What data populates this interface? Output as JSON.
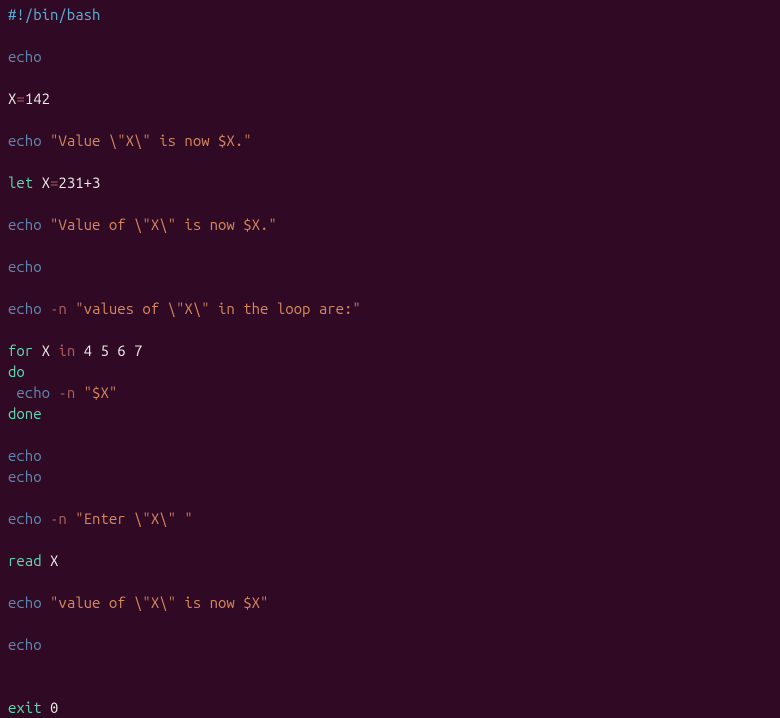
{
  "code": {
    "shebang": "#!/bin/bash",
    "echo_cmd": "echo",
    "var_x": "X",
    "assign_op": "=",
    "val_142": "142",
    "str_value_x_is_now": "\"Value \\\"X\\\" is now $X.\"",
    "let_cmd": "let",
    "let_expr_x": "X",
    "let_expr_eq": "=",
    "let_expr_val": "231+3",
    "str_value_of_x_is_now": "\"Value of \\\"X\\\" is now $X.\"",
    "flag_n": "-n",
    "str_values_in_loop": "\"values of \\\"X\\\" in the loop are:\"",
    "for_kw": "for",
    "in_kw": "in",
    "loop_vals": "4 5 6 7",
    "do_kw": "do",
    "str_dollar_x": "\"$X\"",
    "done_kw": "done",
    "str_enter_x": "\"Enter \\\"X\\\" \"",
    "read_cmd": "read",
    "str_value_of_x_lower": "\"value of \\\"X\\\" is now $X\"",
    "exit_cmd": "exit",
    "exit_code": "0",
    "space": " ",
    "space_indent": " "
  }
}
